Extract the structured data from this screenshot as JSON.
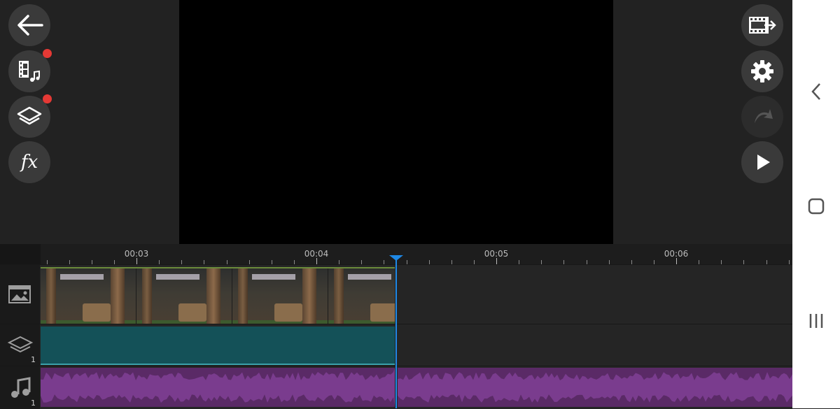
{
  "app": {
    "left_toolbar": [
      {
        "name": "back-button",
        "icon": "back-arrow-icon",
        "has_badge": false
      },
      {
        "name": "media-button",
        "icon": "film-music-icon",
        "has_badge": true
      },
      {
        "name": "layers-button",
        "icon": "layers-icon",
        "has_badge": true
      },
      {
        "name": "effects-button",
        "icon": "fx-icon",
        "label": "fx",
        "has_badge": false
      }
    ],
    "right_toolbar": [
      {
        "name": "export-button",
        "icon": "film-export-icon"
      },
      {
        "name": "settings-button",
        "icon": "gear-icon"
      },
      {
        "name": "undo-button",
        "icon": "undo-icon",
        "disabled": true
      },
      {
        "name": "play-button",
        "icon": "play-icon"
      }
    ]
  },
  "timeline": {
    "ruler_labels": [
      "00:03",
      "00:04",
      "00:05",
      "00:06"
    ],
    "tracks": [
      {
        "name": "video-track",
        "icon": "photo-video-icon",
        "count": ""
      },
      {
        "name": "layer-track",
        "icon": "layers-icon",
        "count": "1"
      },
      {
        "name": "audio-track",
        "icon": "music-note-icon",
        "count": "1"
      }
    ],
    "playhead_color": "#1e88e5",
    "video_clip_frames": 4
  },
  "colors": {
    "layer_clip": "#145158",
    "audio_clip": "#7a3c8e",
    "badge": "#e53935"
  },
  "system_nav": [
    {
      "name": "nav-back-button",
      "icon": "chevron-left-icon"
    },
    {
      "name": "nav-home-button",
      "icon": "home-square-icon"
    },
    {
      "name": "nav-recents-button",
      "icon": "recents-icon"
    }
  ]
}
